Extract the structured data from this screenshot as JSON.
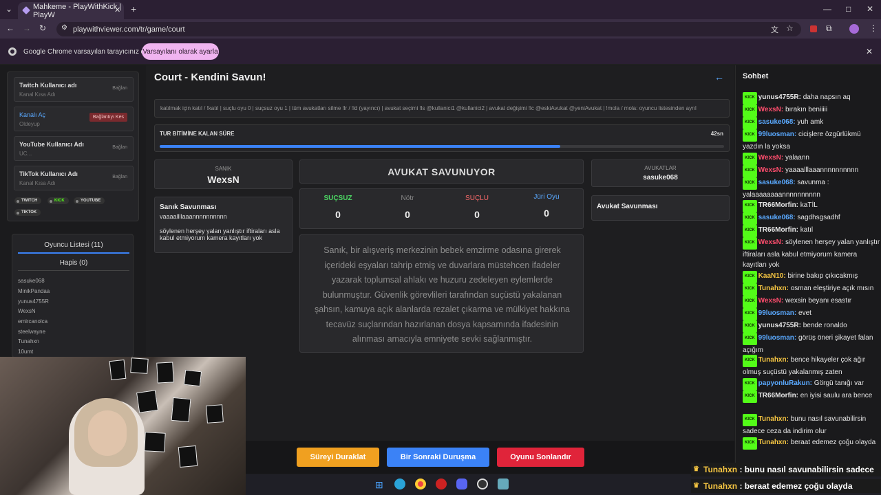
{
  "browser": {
    "tab_title": "Mahkeme - PlayWithKick | PlayW",
    "url": "playwithviewer.com/tr/game/court",
    "infobar_text": "Google Chrome varsayılan tarayıcınız değil",
    "infobar_button": "Varsayılanı olarak ayarla"
  },
  "accounts": [
    {
      "title": "Twitch Kullanıcı adı",
      "sub": "Kanal Kısa Adı",
      "btn": "Bağlan"
    },
    {
      "title": "Kanalı Aç",
      "sub": "Oldeyup",
      "btn": "Bağlantıyı Kes"
    },
    {
      "title": "YouTube Kullanıcı Adı",
      "sub": "UC...",
      "btn": "Bağlan"
    },
    {
      "title": "TikTok Kullanıcı Adı",
      "sub": "Kanal Kısa Adı",
      "btn": "Bağlan"
    }
  ],
  "platforms": [
    "TWITCH",
    "KICK",
    "YOUTUBE",
    "TIKTOK"
  ],
  "players": {
    "tab_list": "Oyuncu Listesi (11)",
    "tab_jail": "Hapis (0)",
    "names": [
      "sasuke068",
      "MinikPandaa",
      "yunus4755R",
      "WexsN",
      "emircanolca",
      "steelwayne",
      "Tunahxn",
      "10umt"
    ]
  },
  "page": {
    "title": "Court - Kendini Savun!",
    "commands": "katılmak için katıl / !katıl | suçlu oyu 0 | suçsuz oyu 1 | tüm avukatları silme !lr / !ld (yayıncı) | avukat seçimi !ls @kullanici1 @kullanici2 | avukat değişimi !lc @eskiAvukat @yeniAvukat | !mola / mola: oyuncu listesinden ayrıl",
    "timer_label": "TUR BİTİMİNE KALAN SÜRE",
    "timer_value": "42sn",
    "timer_progress": 0.71
  },
  "defendant": {
    "label": "SANIK",
    "name": "WexsN",
    "defense_title": "Sanık Savunması",
    "defense_line1": "vaaaallllaaannnnnnnnnn",
    "defense_line2": "söylenen herşey yalan yanlıştır iftiraları asla kabul etmiyorum kamera kayıtları yok"
  },
  "status": "AVUKAT SAVUNUYOR",
  "votes": [
    {
      "label": "SUÇSUZ",
      "value": "0",
      "color": "#4cd964"
    },
    {
      "label": "Nötr",
      "value": "0",
      "color": "#8a8a8a"
    },
    {
      "label": "SUÇLU",
      "value": "0",
      "color": "#ff6b6b"
    },
    {
      "label": "Jüri Oyu",
      "value": "0",
      "color": "#5aa9ff"
    }
  ],
  "case_text": "Sanık, bir alışveriş merkezinin bebek emzirme odasına girerek içerideki eşyaları tahrip etmiş ve duvarlara müstehcen ifadeler yazarak toplumsal ahlakı ve huzuru zedeleyen eylemlerde bulunmuştur. Güvenlik görevlileri tarafından suçüstü yakalanan şahsın, kamuya açık alanlarda rezalet çıkarma ve mülkiyet hakkına tecavüz suçlarından hazırlanan dosya kapsamında ifadesinin alınması amacıyla emniyete sevki sağlanmıştır.",
  "lawyers": {
    "label": "AVUKATLAR",
    "names": "sasuke068",
    "defense_title": "Avukat Savunması"
  },
  "buttons": {
    "pause": "Süreyi Duraklat",
    "next": "Bir Sonraki Duruşma",
    "end": "Oyunu Sonlandır"
  },
  "chat": {
    "title": "Sohbet",
    "badge": "KICK",
    "messages": [
      {
        "user": "yunus4755R:",
        "text": "daha napsın aq",
        "color": "#e6e6e6"
      },
      {
        "user": "WexsN:",
        "text": "bırakın beniiiii",
        "color": "#ff4d6d"
      },
      {
        "user": "sasuke068:",
        "text": "yuh amk",
        "color": "#5aa9ff"
      },
      {
        "user": "99luosman:",
        "text": "cicişlere özgürlükmü yazdın la yoksa",
        "color": "#5aa9ff"
      },
      {
        "user": "WexsN:",
        "text": "yalaann",
        "color": "#ff4d6d"
      },
      {
        "user": "WexsN:",
        "text": "yaaaalllaaannnnnnnnnn",
        "color": "#ff4d6d"
      },
      {
        "user": "sasuke068:",
        "text": "savunma : yalaaaaaaaannnnnnnnnn",
        "color": "#5aa9ff"
      },
      {
        "user": "TR66Morfin:",
        "text": "kaTİL",
        "color": "#e6e6e6"
      },
      {
        "user": "sasuke068:",
        "text": "sagdhsgsadhf",
        "color": "#5aa9ff"
      },
      {
        "user": "TR66Morfin:",
        "text": "katıl",
        "color": "#e6e6e6"
      },
      {
        "user": "WexsN:",
        "text": "söylenen herşey yalan yanlıştır iftiraları asla kabul etmiyorum kamera kayıtları yok",
        "color": "#ff4d6d"
      },
      {
        "user": "KaaN10:",
        "text": "birine bakıp çıkıcakmış",
        "color": "#f5c542"
      },
      {
        "user": "Tunahxn:",
        "text": "osman eleştiriye açık mısın",
        "color": "#f5c542"
      },
      {
        "user": "WexsN:",
        "text": "wexsin beyanı esastır",
        "color": "#ff4d6d"
      },
      {
        "user": "99luosman:",
        "text": "evet",
        "color": "#5aa9ff"
      },
      {
        "user": "yunus4755R:",
        "text": "bende ronaldo",
        "color": "#e6e6e6"
      },
      {
        "user": "99luosman:",
        "text": "görüş öneri şikayet falan açığım",
        "color": "#5aa9ff"
      },
      {
        "user": "Tunahxn:",
        "text": "bence hikayeler çok ağır olmuş suçüstü yakalanmış zaten",
        "color": "#f5c542"
      },
      {
        "user": "papyonluRakun:",
        "text": "Görgü tanığı var",
        "color": "#5aa9ff"
      },
      {
        "user": "TR66Morfin:",
        "text": "en iyisi saulu ara bence",
        "color": "#e6e6e6"
      },
      {
        "user": "Tunahxn:",
        "text": "bunu nasıl savunabilirsin sadece ceza da indirim olur",
        "color": "#f5c542"
      },
      {
        "user": "Tunahxn:",
        "text": "beraat edemez çoğu olayda",
        "color": "#f5c542"
      }
    ]
  },
  "overlay": [
    {
      "user": "Tunahxn",
      "text": ": bunu nasıl savunabilirsin sadece"
    },
    {
      "user": "Tunahxn",
      "text": ": beraat edemez çoğu olayda"
    }
  ]
}
